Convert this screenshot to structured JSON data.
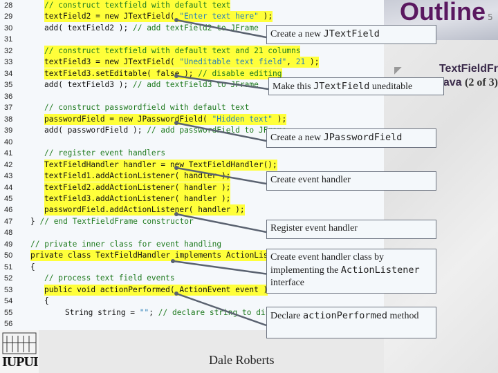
{
  "header": {
    "title": "Outline",
    "page_number": "5"
  },
  "file": {
    "name_bold": "TextFieldFr\nava",
    "name_part": "(2 of 3)"
  },
  "footer": {
    "author": "Dale Roberts",
    "logo": "IUPUI"
  },
  "colors": {
    "highlight": "#ffff3a",
    "comment": "#1f7a1f",
    "string": "#2a7fb8",
    "title": "#5a1860"
  },
  "code_lines": [
    {
      "num": "28",
      "indent": 6,
      "hl": true,
      "seg": [
        [
          "c",
          "// construct textfield with default text"
        ]
      ]
    },
    {
      "num": "29",
      "indent": 6,
      "hl": true,
      "seg": [
        [
          "k",
          "textField2 = new JTextField( "
        ],
        [
          "s",
          "\"Enter text here\""
        ],
        [
          "k",
          " );"
        ]
      ]
    },
    {
      "num": "30",
      "indent": 6,
      "hl": false,
      "seg": [
        [
          "k",
          "add( textField2 ); "
        ],
        [
          "c",
          "// add textField2 to JFrame"
        ]
      ]
    },
    {
      "num": "31",
      "indent": 6,
      "hl": false,
      "seg": []
    },
    {
      "num": "32",
      "indent": 6,
      "hl": true,
      "seg": [
        [
          "c",
          "// construct textfield with default text and 21 columns"
        ]
      ]
    },
    {
      "num": "33",
      "indent": 6,
      "hl": true,
      "seg": [
        [
          "k",
          "textField3 = new JTextField( "
        ],
        [
          "s",
          "\"Uneditable text field\""
        ],
        [
          "k",
          ", "
        ],
        [
          "s",
          "21"
        ],
        [
          "k",
          " );"
        ]
      ]
    },
    {
      "num": "34",
      "indent": 6,
      "hl": true,
      "seg": [
        [
          "k",
          "textField3.setEditable( false ); "
        ],
        [
          "c",
          "// disable editing"
        ]
      ]
    },
    {
      "num": "35",
      "indent": 6,
      "hl": false,
      "seg": [
        [
          "k",
          "add( textField3 ); "
        ],
        [
          "c",
          "// add textField3 to JFrame"
        ]
      ]
    },
    {
      "num": "36",
      "indent": 6,
      "hl": false,
      "seg": []
    },
    {
      "num": "37",
      "indent": 6,
      "hl": false,
      "seg": [
        [
          "c",
          "// construct passwordfield with default text"
        ]
      ]
    },
    {
      "num": "38",
      "indent": 6,
      "hl": true,
      "seg": [
        [
          "k",
          "passwordField = new JPasswordField( "
        ],
        [
          "s",
          "\"Hidden text\""
        ],
        [
          "k",
          " );"
        ]
      ]
    },
    {
      "num": "39",
      "indent": 6,
      "hl": false,
      "seg": [
        [
          "k",
          "add( passwordField ); "
        ],
        [
          "c",
          "// add passwordField to JFrame"
        ]
      ]
    },
    {
      "num": "40",
      "indent": 6,
      "hl": false,
      "seg": []
    },
    {
      "num": "41",
      "indent": 6,
      "hl": false,
      "seg": [
        [
          "c",
          "// register event handlers"
        ]
      ]
    },
    {
      "num": "42",
      "indent": 6,
      "hl": true,
      "seg": [
        [
          "k",
          "TextFieldHandler handler = new TextFieldHandler();"
        ]
      ]
    },
    {
      "num": "43",
      "indent": 6,
      "hl": true,
      "seg": [
        [
          "k",
          "textField1.addActionListener( handler );"
        ]
      ]
    },
    {
      "num": "44",
      "indent": 6,
      "hl": true,
      "seg": [
        [
          "k",
          "textField2.addActionListener( handler );"
        ]
      ]
    },
    {
      "num": "45",
      "indent": 6,
      "hl": true,
      "seg": [
        [
          "k",
          "textField3.addActionListener( handler );"
        ]
      ]
    },
    {
      "num": "46",
      "indent": 6,
      "hl": true,
      "seg": [
        [
          "k",
          "passwordField.addActionListener( handler );"
        ]
      ]
    },
    {
      "num": "47",
      "indent": 4,
      "hl": false,
      "seg": [
        [
          "k",
          "} "
        ],
        [
          "c",
          "// end TextFieldFrame constructor"
        ]
      ]
    },
    {
      "num": "48",
      "indent": 4,
      "hl": false,
      "seg": []
    },
    {
      "num": "49",
      "indent": 4,
      "hl": false,
      "seg": [
        [
          "c",
          "// private inner class for event handling"
        ]
      ]
    },
    {
      "num": "50",
      "indent": 4,
      "hl": true,
      "seg": [
        [
          "k",
          "private class TextFieldHandler implements ActionListener"
        ]
      ]
    },
    {
      "num": "51",
      "indent": 4,
      "hl": false,
      "seg": [
        [
          "k",
          "{"
        ]
      ]
    },
    {
      "num": "52",
      "indent": 6,
      "hl": false,
      "seg": [
        [
          "c",
          "// process text field events"
        ]
      ]
    },
    {
      "num": "53",
      "indent": 6,
      "hl": true,
      "seg": [
        [
          "k",
          "public void actionPerformed( ActionEvent event )"
        ]
      ]
    },
    {
      "num": "54",
      "indent": 6,
      "hl": false,
      "seg": [
        [
          "k",
          "{"
        ]
      ]
    },
    {
      "num": "55",
      "indent": 9,
      "hl": false,
      "seg": [
        [
          "k",
          "String string = "
        ],
        [
          "s",
          "\"\""
        ],
        [
          "k",
          "; "
        ],
        [
          "c",
          "// declare string to display"
        ]
      ]
    },
    {
      "num": "56",
      "indent": 6,
      "hl": false,
      "seg": []
    }
  ],
  "callouts": [
    {
      "parts": [
        [
          "t",
          "Create a new "
        ],
        [
          "m",
          "JTextField"
        ]
      ]
    },
    {
      "parts": [
        [
          "t",
          "Make this "
        ],
        [
          "m",
          "JTextField"
        ],
        [
          "t",
          " uneditable"
        ]
      ]
    },
    {
      "parts": [
        [
          "t",
          "Create a new "
        ],
        [
          "m",
          "JPasswordField"
        ]
      ]
    },
    {
      "parts": [
        [
          "t",
          "Create event handler"
        ]
      ]
    },
    {
      "parts": [
        [
          "t",
          "Register event handler"
        ]
      ]
    },
    {
      "parts": [
        [
          "t",
          "Create event handler class by implementing the "
        ],
        [
          "m",
          "ActionListener"
        ],
        [
          "t",
          " interface"
        ]
      ]
    },
    {
      "parts": [
        [
          "t",
          "Declare "
        ],
        [
          "m",
          "actionPerformed"
        ],
        [
          "t",
          " method"
        ]
      ]
    }
  ]
}
